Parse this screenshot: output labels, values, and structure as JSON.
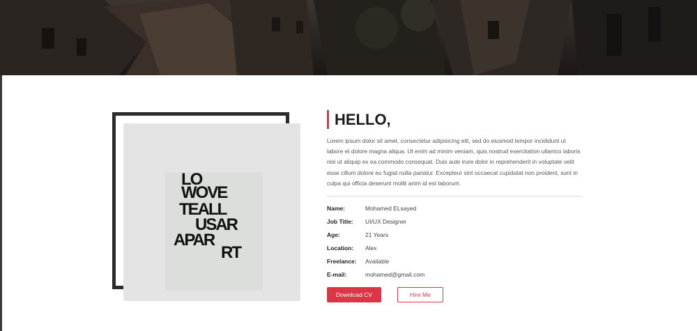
{
  "about": {
    "title": "HELLO,",
    "description": "Lorem ipsum dolor sit amet, consectetur adipisicing elit, sed do eiusmod tempor incididunt ut labore et dolore magna aliqua. Ut enim ad minim veniam, quis nostrud exercitation ullamco laboris nisi ut aliquip ex ea commodo consequat. Duis aute irure dolor in reprehenderit in voluptate velit esse cillum dolore eu fugiat nulla pariatur. Excepteur sint occaecat cupidatat non proident, sunt in culpa qui officia deserunt mollit anim id est laborum.",
    "info": [
      {
        "label": "Name:",
        "value": "Mohamed ELsayed"
      },
      {
        "label": "Job Title:",
        "value": "UI/UX Designer"
      },
      {
        "label": "Age:",
        "value": "21 Years"
      },
      {
        "label": "Location:",
        "value": "Alex"
      },
      {
        "label": "Freelance:",
        "value": "Available"
      },
      {
        "label": "E-mail:",
        "value": "mohamed@gmail.com"
      }
    ],
    "buttons": {
      "download": "Download CV",
      "hire": "Hire Me"
    }
  },
  "photo": {
    "lines": [
      "LO",
      "WOVE",
      "TEALL",
      "USAR",
      "APAR",
      "RT"
    ]
  },
  "colors": {
    "accent": "#dc3545",
    "frame": "#2c2c2c",
    "photo_bg": "#e2e3e2"
  }
}
